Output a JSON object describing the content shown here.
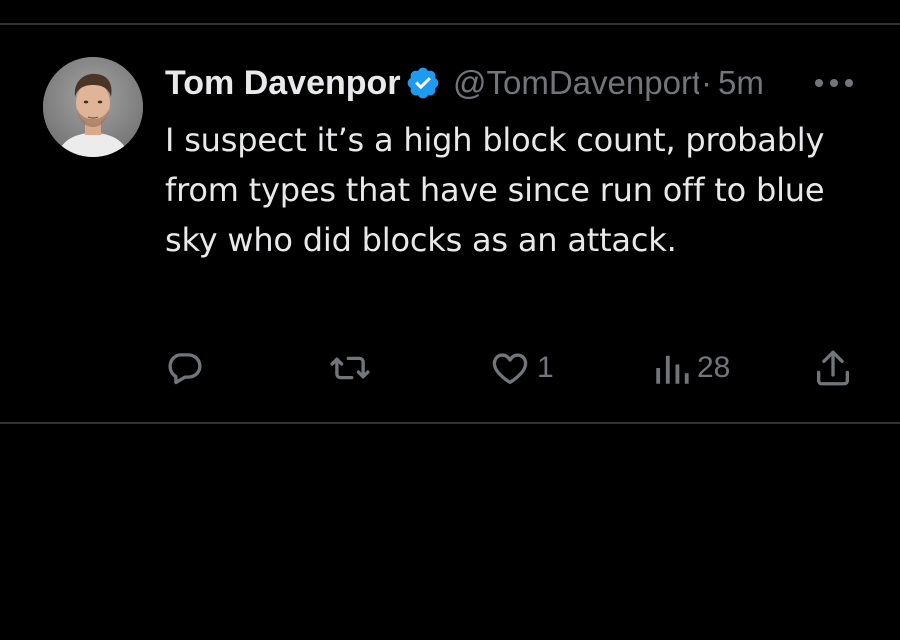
{
  "tweet": {
    "display_name": "Tom Davenport",
    "handle": "@TomDavenport",
    "separator": "·",
    "time": "5m",
    "body": "I suspect it’s a high block count, probably from types that have since run off to blue sky who did blocks as an attack.",
    "verified": true
  },
  "actions": {
    "reply_icon": "reply-icon",
    "retweet_icon": "retweet-icon",
    "like_icon": "heart-icon",
    "like_count": "1",
    "views_icon": "views-chart-icon",
    "views_count": "28",
    "share_icon": "share-icon"
  },
  "colors": {
    "background": "#000000",
    "text": "#e7e9ea",
    "secondary": "#71767b",
    "verified": "#1d9bf0",
    "divider": "#2f3336"
  }
}
